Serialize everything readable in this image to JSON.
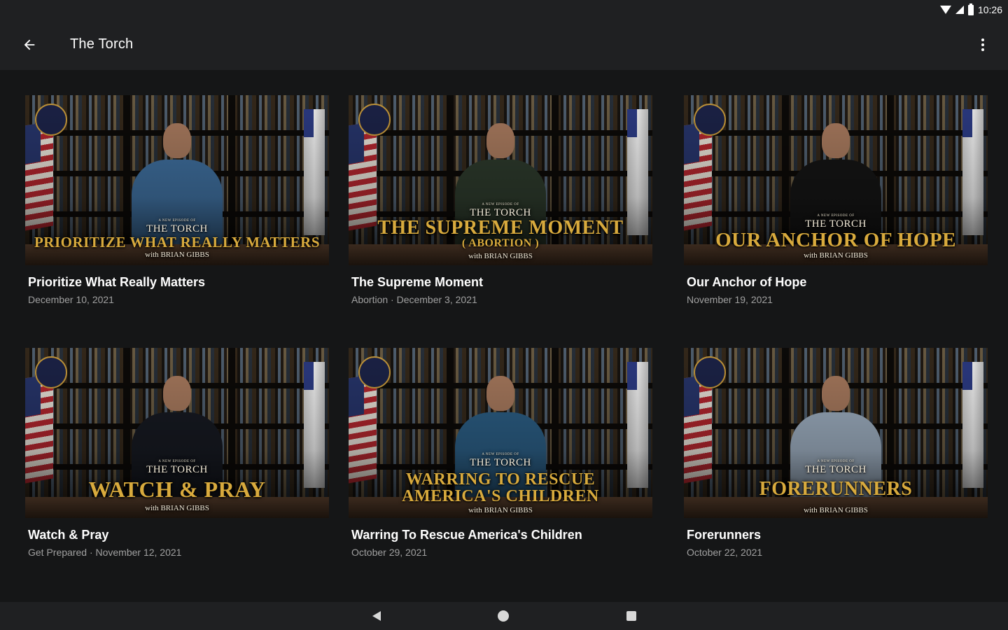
{
  "status": {
    "time": "10:26"
  },
  "appbar": {
    "title": "The Torch"
  },
  "overlay": {
    "small": "A NEW EPISODE OF",
    "brand": "THE TORCH",
    "with": "with BRIAN GIBBS"
  },
  "colors": {
    "background": "#151617",
    "bar": "#1f2022",
    "subtitle": "#a0a0a0",
    "overlay_gold": "#d8aa3d"
  },
  "icons": {
    "back": "arrow-left-icon",
    "more": "more-vert-icon",
    "wifi": "wifi-icon",
    "signal": "signal-icon",
    "battery": "battery-icon"
  },
  "episodes": [
    {
      "title": "Prioritize What Really Matters",
      "subtitle": "December 10, 2021",
      "overlay_title": "PRIORITIZE WHAT REALLY MATTERS",
      "overlay_sub": "",
      "shirt": "#3f6f9e"
    },
    {
      "title": "The Supreme Moment",
      "subtitle": "Abortion · December 3, 2021",
      "overlay_title": "THE SUPREME MOMENT",
      "overlay_sub": "( ABORTION )",
      "shirt": "#2d3a2c"
    },
    {
      "title": "Our Anchor of Hope",
      "subtitle": "November 19, 2021",
      "overlay_title": "OUR ANCHOR OF HOPE",
      "overlay_sub": "",
      "shirt": "#151515"
    },
    {
      "title": "Watch & Pray",
      "subtitle": "Get Prepared · November 12, 2021",
      "overlay_title": "WATCH & PRAY",
      "overlay_sub": "",
      "shirt": "#171a22"
    },
    {
      "title": "Warring To Rescue America's Children",
      "subtitle": "October 29, 2021",
      "overlay_title": "WARRING TO RESCUE AMERICA'S CHILDREN",
      "overlay_sub": "",
      "shirt": "#2c5f86"
    },
    {
      "title": "Forerunners",
      "subtitle": "October 22, 2021",
      "overlay_title": "FORERUNNERS",
      "overlay_sub": "",
      "shirt": "#9fb0c2"
    }
  ]
}
